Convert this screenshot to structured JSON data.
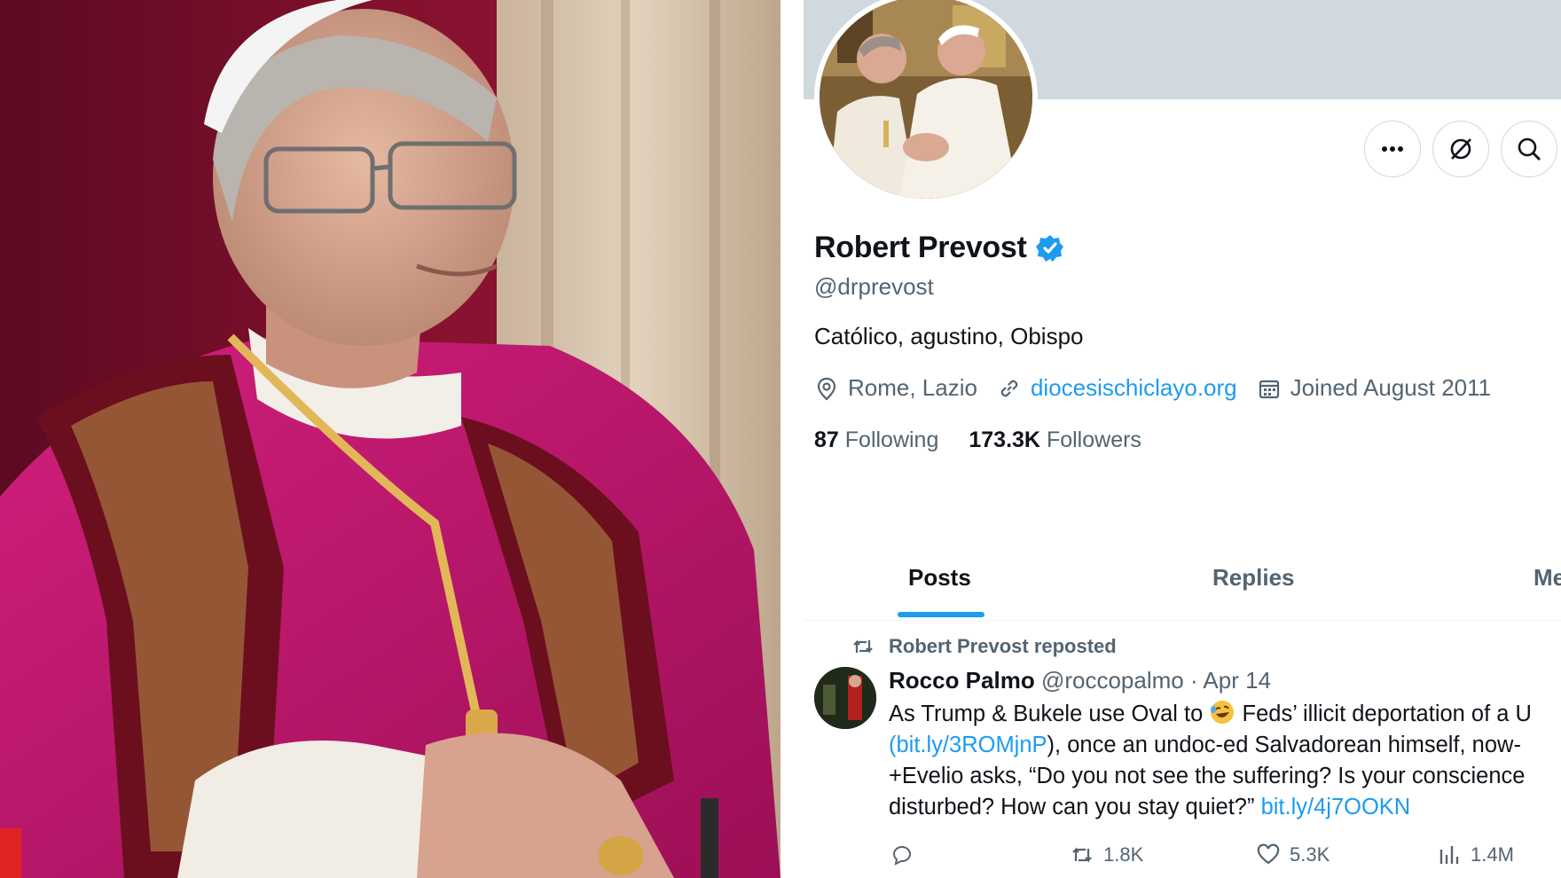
{
  "profile": {
    "display_name": "Robert Prevost",
    "handle": "@drprevost",
    "bio": "Católico, agustino, Obispo",
    "location": "Rome, Lazio",
    "website": "diocesischiclayo.org",
    "joined": "Joined August 2011",
    "following_count": "87",
    "following_label": "Following",
    "followers_count": "173.3K",
    "followers_label": "Followers"
  },
  "tabs": [
    {
      "label": "Posts"
    },
    {
      "label": "Replies"
    },
    {
      "label": "Me"
    }
  ],
  "tweet": {
    "repost_label": "Robert Prevost reposted",
    "author": "Rocco Palmo",
    "handle": "@roccopalmo",
    "separator": " · ",
    "date": "Apr 14",
    "line1_a": "As Trump & Bukele use Oval to ",
    "line1_b": " Feds’ illicit deportation of a U",
    "line2_link": "(bit.ly/3ROMjnP",
    "line2_rest": "), once an undoc-ed Salvadorean himself, now-",
    "line3": "+Evelio asks, “Do you not see the suffering? Is your conscience",
    "line4_text": "disturbed? How can you stay quiet?” ",
    "line4_link": "bit.ly/4j7OOKN",
    "retweets": "1.8K",
    "likes": "5.3K",
    "views": "1.4M"
  },
  "colors": {
    "accent": "#1d9bf0",
    "text_primary": "#0f1419",
    "text_secondary": "#536471",
    "banner": "#cfd9de",
    "vestment_magenta": "#c4186e",
    "mozzetta_red": "#7a0f25"
  },
  "icons": {
    "more": "more-horizontal-icon",
    "sync": "grok-icon",
    "search": "search-icon",
    "verified": "verified-badge-icon",
    "location": "location-pin-icon",
    "link": "link-icon",
    "calendar": "calendar-icon",
    "repost": "repost-icon",
    "reply": "reply-icon",
    "like": "heart-icon",
    "views": "views-bar-chart-icon",
    "emoji": "rolling-laughing-emoji"
  }
}
